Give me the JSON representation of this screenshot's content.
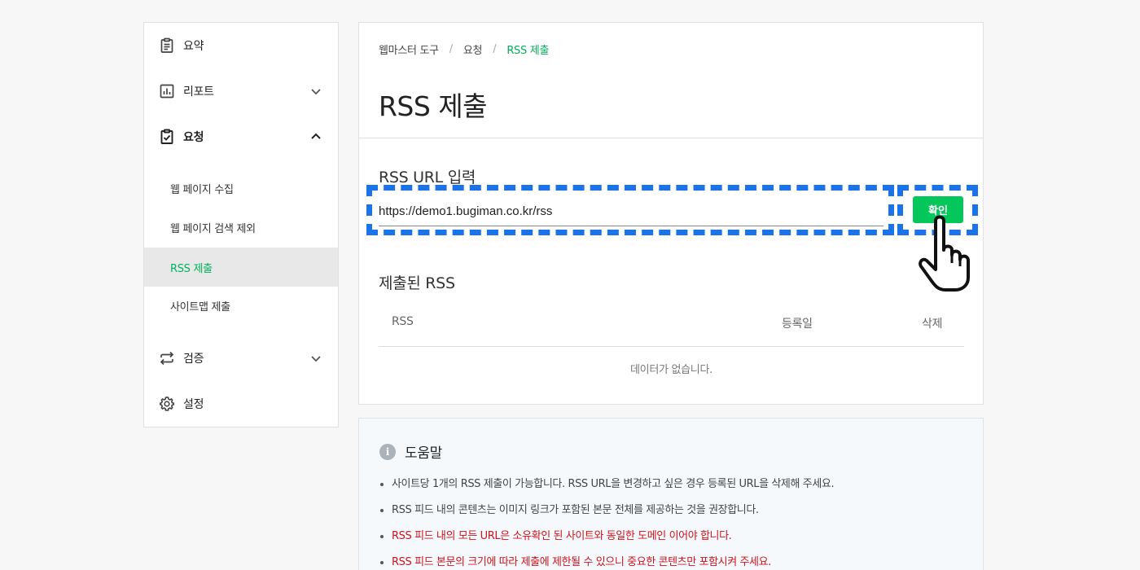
{
  "sidebar": {
    "items": [
      {
        "label": "요약",
        "icon": "clipboard-icon"
      },
      {
        "label": "리포트",
        "icon": "chart-icon",
        "chevron": "down"
      },
      {
        "label": "요청",
        "icon": "clipboard-check-icon",
        "chevron": "up",
        "expanded": true
      },
      {
        "label": "검증",
        "icon": "repeat-icon",
        "chevron": "down"
      },
      {
        "label": "설정",
        "icon": "gear-icon"
      }
    ],
    "sub_items": [
      {
        "label": "웹 페이지 수집"
      },
      {
        "label": "웹 페이지 검색 제외"
      },
      {
        "label": "RSS 제출",
        "active": true
      },
      {
        "label": "사이트맵 제출"
      }
    ]
  },
  "breadcrumb": [
    "웹마스터 도구",
    "요청",
    "RSS 제출"
  ],
  "page_title": "RSS 제출",
  "rss_input": {
    "section_title": "RSS URL 입력",
    "value": "https://demo1.bugiman.co.kr/rss",
    "button_label": "확인"
  },
  "submitted": {
    "section_title": "제출된 RSS",
    "columns": [
      "RSS",
      "등록일",
      "삭제"
    ],
    "empty_text": "데이터가 없습니다."
  },
  "help": {
    "title": "도움말",
    "items": [
      {
        "text": "사이트당 1개의 RSS 제출이 가능합니다. RSS URL을 변경하고 싶은 경우 등록된 URL을 삭제해 주세요.",
        "warn": false
      },
      {
        "text": "RSS 피드 내의 콘텐츠는 이미지 링크가 포함된 본문 전체를 제공하는 것을 권장합니다.",
        "warn": false
      },
      {
        "text": "RSS 피드 내의 모든 URL은 소유확인 된 사이트와 동일한 도메인 이어야 합니다.",
        "warn": true
      },
      {
        "text": "RSS 피드 본문의 크기에 따라 제출에 제한될 수 있으니 중요한 콘텐츠만 포함시켜 주세요.",
        "warn": true
      }
    ]
  },
  "colors": {
    "accent_green": "#03c75a",
    "highlight_blue": "#1a73e8",
    "warning_red": "#d1121c"
  }
}
